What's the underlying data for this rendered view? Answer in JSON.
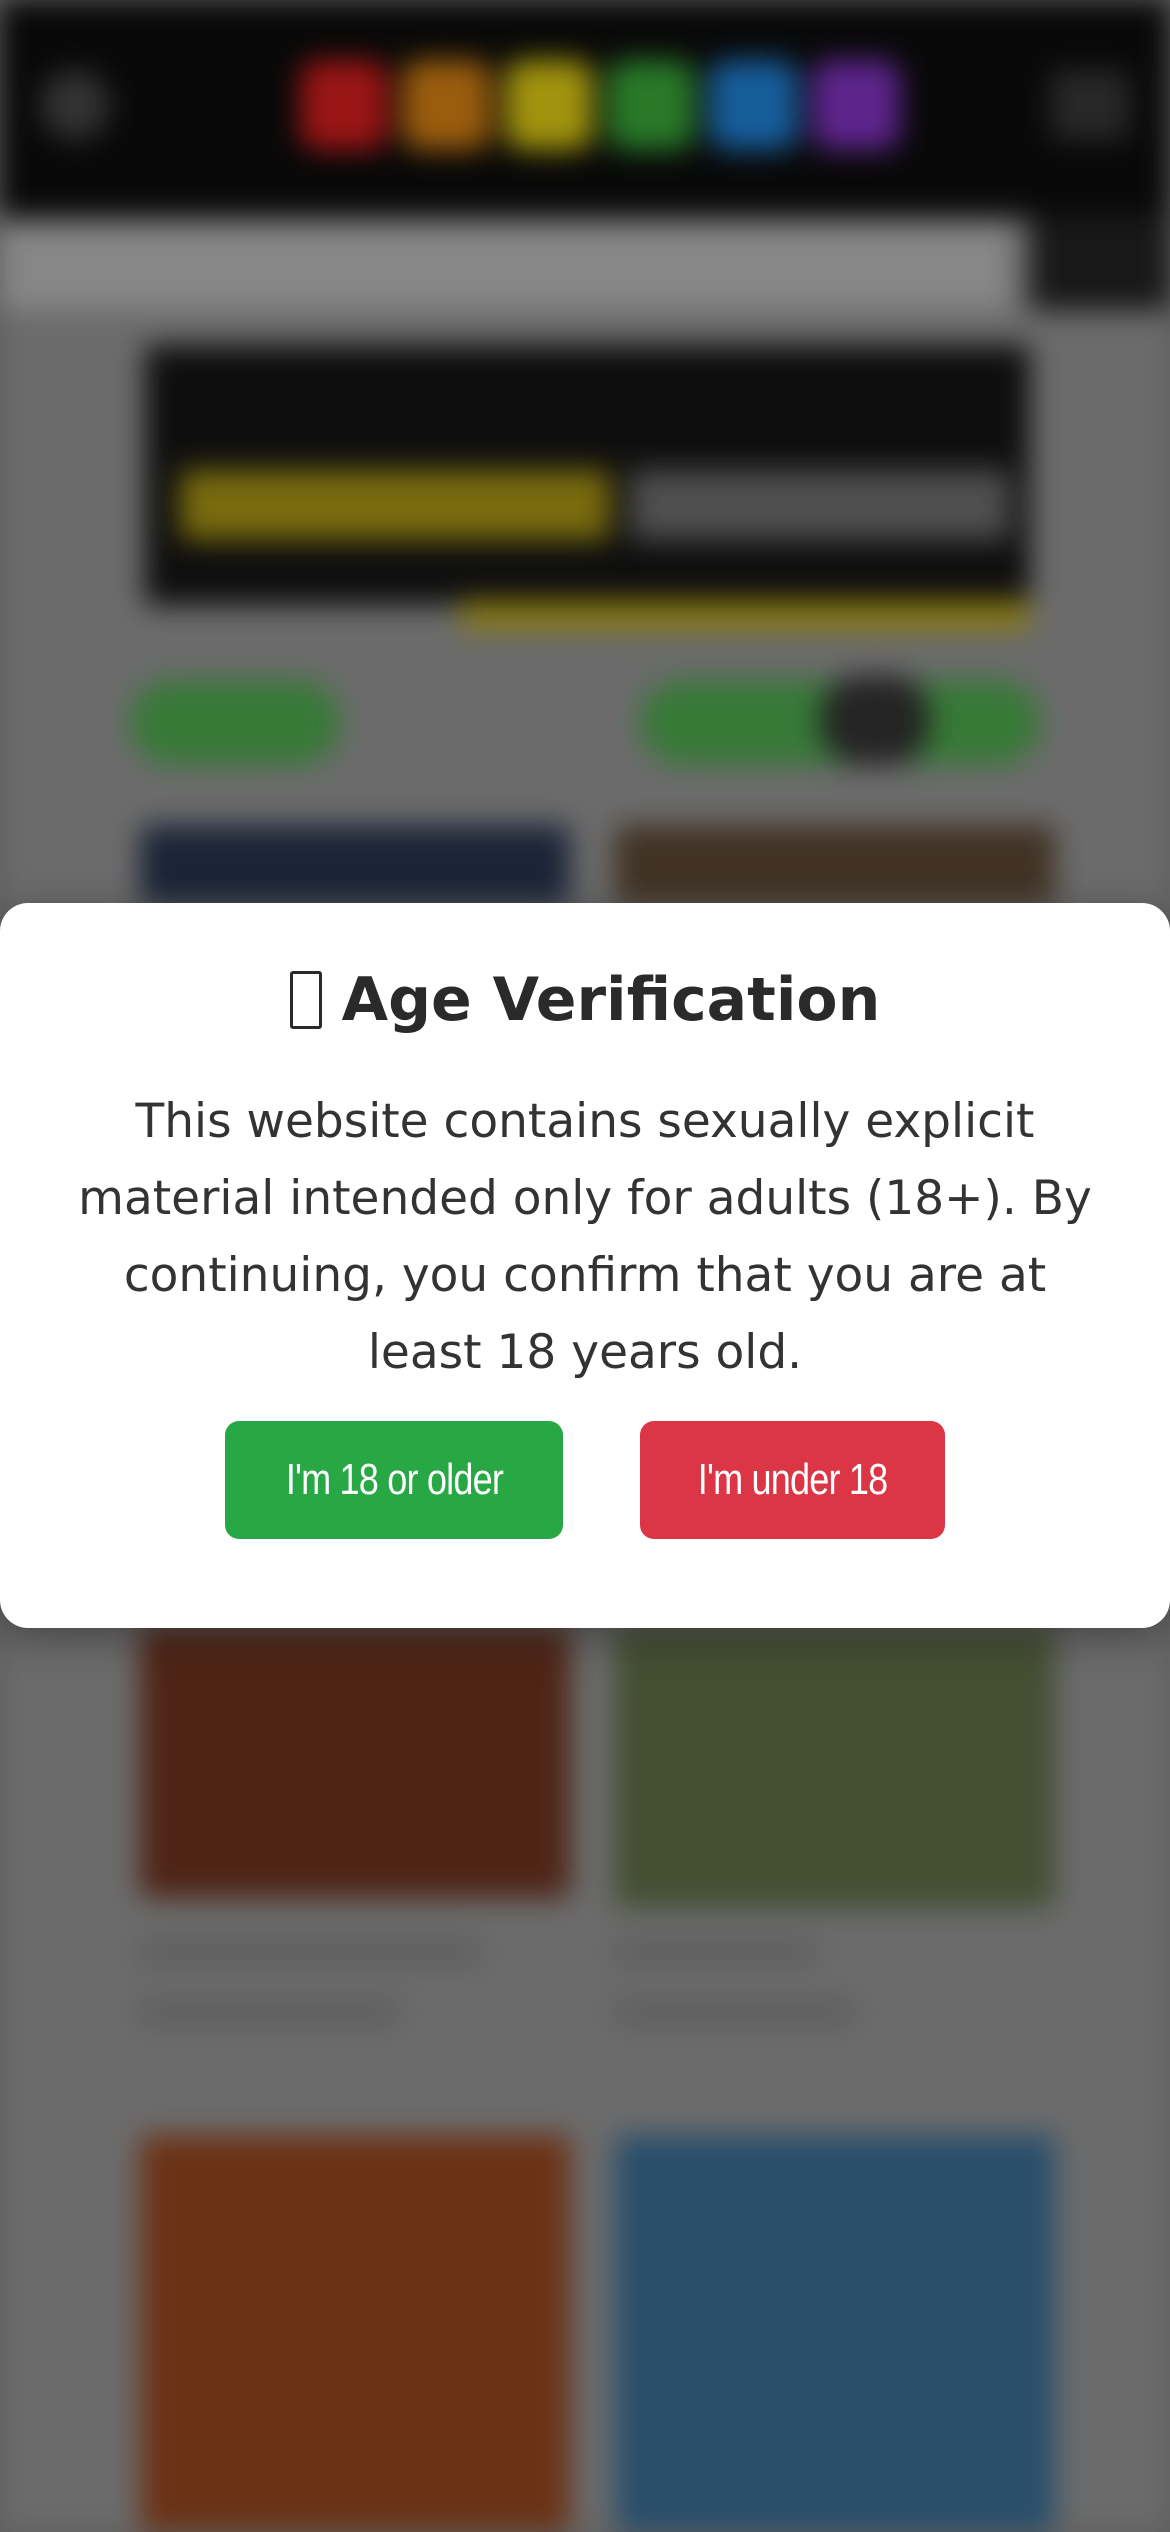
{
  "modal": {
    "title_icon": "lock-icon",
    "title": "Age Verification",
    "message": "This website contains sexually explicit material intended only for adults (18+). By continuing, you confirm that you are at least 18 years old.",
    "confirm_label": "I'm 18 or older",
    "deny_label": "I'm under 18"
  },
  "colors": {
    "confirm": "#28a745",
    "deny": "#dc3545",
    "logo": [
      "#b01818",
      "#b06a10",
      "#b8a810",
      "#2f8a2f",
      "#1a6ab0",
      "#6a2aa0"
    ]
  }
}
